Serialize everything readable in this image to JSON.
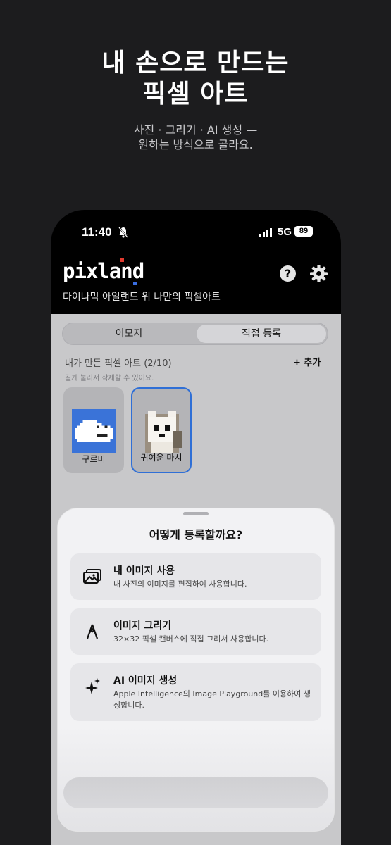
{
  "hero": {
    "title_line1": "내 손으로 만드는",
    "title_line2": "픽셀 아트",
    "subtitle_line1": "사진 · 그리기 · AI 생성 —",
    "subtitle_line2": "원하는 방식으로 골라요."
  },
  "status_bar": {
    "time": "11:40",
    "network": "5G",
    "battery": "89"
  },
  "app": {
    "logo": "pixland",
    "tagline": "다이나믹 아일랜드 위 나만의 픽셀아트",
    "help_icon": "question-circle-icon",
    "settings_icon": "gear-icon"
  },
  "tabs": [
    {
      "label": "이모지",
      "selected": false
    },
    {
      "label": "직접 등록",
      "selected": true
    }
  ],
  "library": {
    "section_title": "내가 만든 픽셀 아트 (2/10)",
    "add_label": "추가",
    "hint": "길게 눌러서 삭제할 수 있어요.",
    "items": [
      {
        "label": "구르미"
      },
      {
        "label": "귀여운 마시"
      }
    ]
  },
  "sheet": {
    "title": "어떻게 등록할까요?",
    "options": [
      {
        "title": "내 이미지 사용",
        "desc": "내 사진의 이미지를 편집하여 사용합니다.",
        "icon": "photos-icon"
      },
      {
        "title": "이미지 그리기",
        "desc": "32×32 픽셀 캔버스에 직접 그려서 사용합니다.",
        "icon": "pen-tip-icon"
      },
      {
        "title": "AI 이미지 생성",
        "desc": "Apple Intelligence의 Image Playground를 이용하여 생성합니다.",
        "icon": "sparkles-icon"
      }
    ]
  },
  "colors": {
    "accent": "#2f6fd6",
    "background": "#1c1c1e",
    "sheet": "#f2f2f4"
  }
}
